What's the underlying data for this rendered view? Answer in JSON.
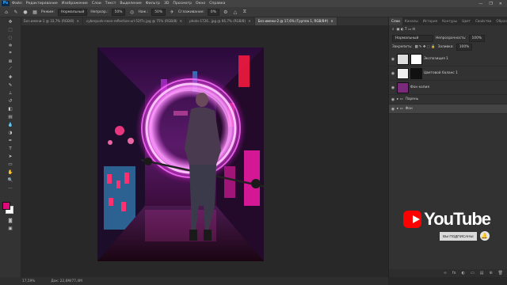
{
  "app": {
    "logo": "Ps"
  },
  "menu": [
    "Файл",
    "Редактирование",
    "Изображение",
    "Слои",
    "Текст",
    "Выделение",
    "Фильтр",
    "3D",
    "Просмотр",
    "Окно",
    "Справка"
  ],
  "window_controls": [
    "—",
    "❐",
    "✕"
  ],
  "options": {
    "mode_label": "Режим:",
    "mode_value": "Нормальный",
    "opacity_label": "Непрозр.:",
    "opacity_value": "50%",
    "flow_label": "Наж.:",
    "flow_value": "50%",
    "smooth_label": "Сглаживание:",
    "smooth_value": "0%"
  },
  "tabs": [
    "Без имени-1 @ 33,7% (RGB/8)",
    "cyberpunk-neon-reflection-url-52f7c.jpg @ 75% (RGB/8)",
    "photo-1726...jpg @ 66,7% (RGB/8)",
    "Без имени-2 @ 17,6% (Группа 1, RGB/8#)"
  ],
  "active_tab": 3,
  "panels": {
    "tabs": [
      "Слои",
      "Каналы",
      "История",
      "Контуры",
      "Цвет",
      "Свойства",
      "Образцы"
    ],
    "blend_mode": "Нормальный",
    "opacity_label": "Непрозрачность:",
    "opacity_value": "100%",
    "lock_label": "Закрепить:",
    "fill_label": "Заливка:",
    "fill_value": "100%",
    "layers": [
      {
        "name": "Экспозиция 1",
        "thumb": "#ddd"
      },
      {
        "name": "Цветовой баланс 1",
        "thumb": "#eee"
      },
      {
        "name": "Фон копия",
        "thumb": "#7a2a7a"
      },
      {
        "name": "Парень",
        "thumb": "none"
      },
      {
        "name": "Фон",
        "thumb": "none"
      }
    ],
    "bottom_icons": [
      "fx",
      "◐",
      "▭",
      "▤",
      "⊕",
      "🗑"
    ]
  },
  "status": {
    "zoom": "17,59%",
    "doc": "Док: 22,6M/77,4M"
  },
  "overlay": {
    "brand": "YouTube",
    "subscribed": "ВЫ ПОДПИСАНЫ"
  },
  "colors": {
    "foreground": "#e0097a",
    "background": "#ffffff"
  }
}
